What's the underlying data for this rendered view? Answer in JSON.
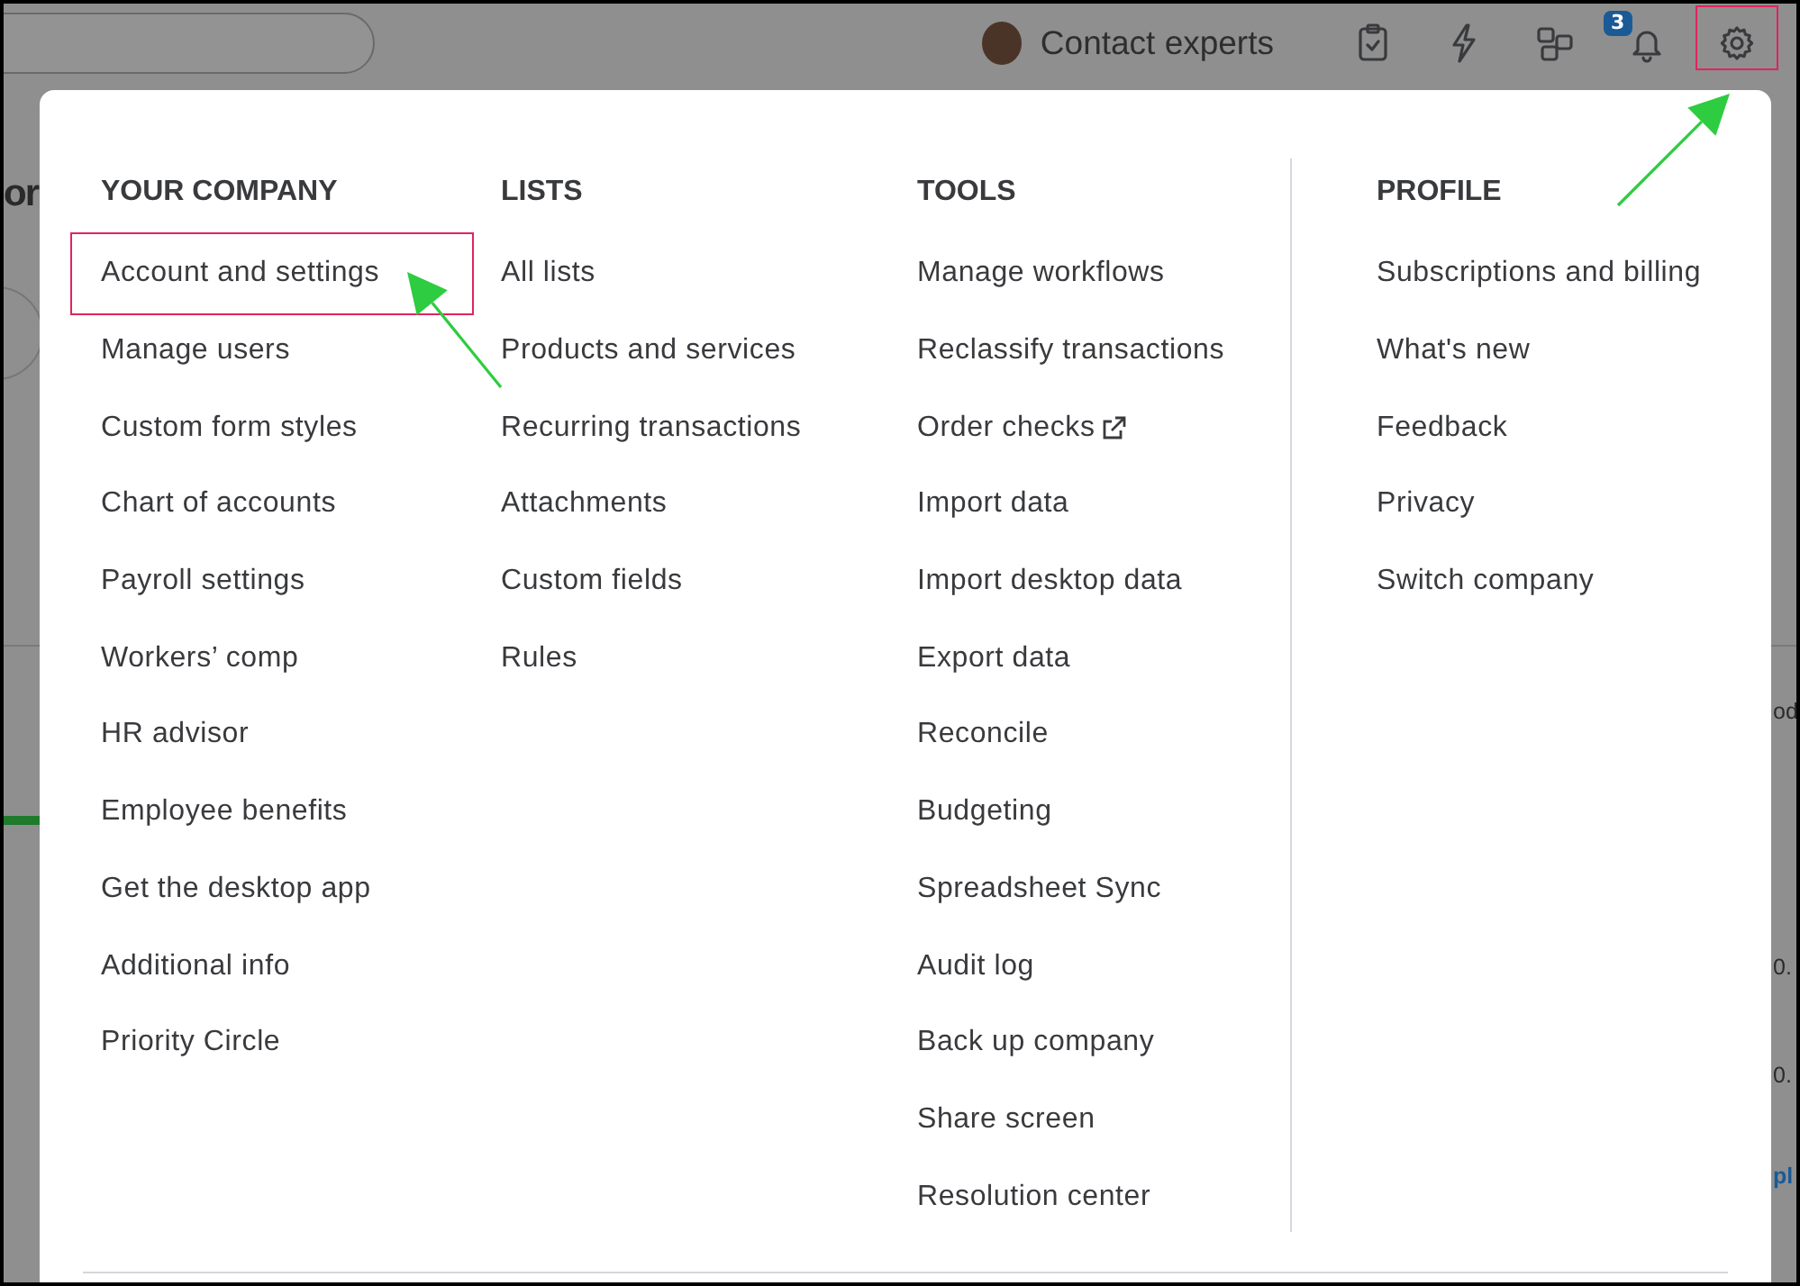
{
  "top_bar": {
    "contact_label": "Contact experts",
    "notification_count": "3",
    "settings_highlighted": true
  },
  "background_fragments": {
    "left_heading": "or",
    "right_texts": [
      "od",
      "0.",
      "0."
    ],
    "right_link": "pl"
  },
  "menu": {
    "columns": [
      {
        "heading": "YOUR COMPANY",
        "items": [
          {
            "label": "Account and settings",
            "highlighted": true
          },
          {
            "label": "Manage users",
            "highlighted": false
          },
          {
            "label": "Custom form styles",
            "highlighted": false
          },
          {
            "label": "Chart of accounts",
            "highlighted": false
          },
          {
            "label": "Payroll settings",
            "highlighted": false
          },
          {
            "label": "Workers’ comp",
            "highlighted": false
          },
          {
            "label": "HR advisor",
            "highlighted": false
          },
          {
            "label": "Employee benefits",
            "highlighted": false
          },
          {
            "label": "Get the desktop app",
            "highlighted": false
          },
          {
            "label": "Additional info",
            "highlighted": false
          },
          {
            "label": "Priority Circle",
            "highlighted": false
          }
        ]
      },
      {
        "heading": "LISTS",
        "items": [
          {
            "label": "All lists"
          },
          {
            "label": "Products and services"
          },
          {
            "label": "Recurring transactions"
          },
          {
            "label": "Attachments"
          },
          {
            "label": "Custom fields"
          },
          {
            "label": "Rules"
          }
        ]
      },
      {
        "heading": "TOOLS",
        "items": [
          {
            "label": "Manage workflows",
            "external": false
          },
          {
            "label": "Reclassify transactions",
            "external": false
          },
          {
            "label": "Order checks",
            "external": true
          },
          {
            "label": "Import data",
            "external": false
          },
          {
            "label": "Import desktop data",
            "external": false
          },
          {
            "label": "Export data",
            "external": false
          },
          {
            "label": "Reconcile",
            "external": false
          },
          {
            "label": "Budgeting",
            "external": false
          },
          {
            "label": "Spreadsheet Sync",
            "external": false
          },
          {
            "label": "Audit log",
            "external": false
          },
          {
            "label": "Back up company",
            "external": false
          },
          {
            "label": "Share screen",
            "external": false
          },
          {
            "label": "Resolution center",
            "external": false
          }
        ]
      },
      {
        "heading": "PROFILE",
        "items": [
          {
            "label": "Subscriptions and billing"
          },
          {
            "label": "What's new"
          },
          {
            "label": "Feedback"
          },
          {
            "label": "Privacy"
          },
          {
            "label": "Switch company"
          }
        ]
      }
    ]
  }
}
